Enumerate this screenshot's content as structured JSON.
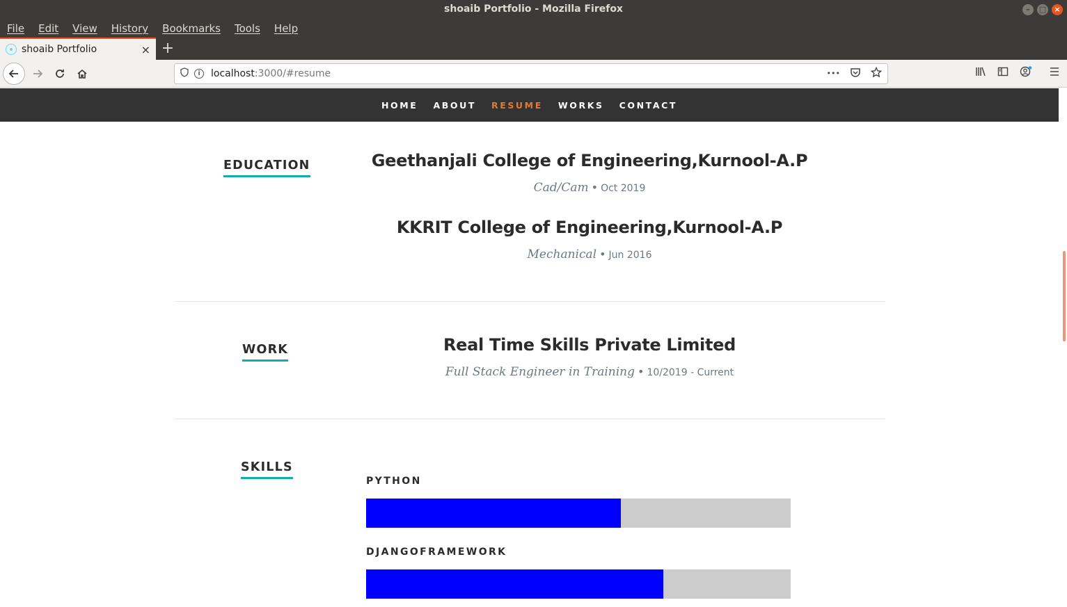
{
  "window": {
    "title": "shoaib Portfolio - Mozilla Firefox"
  },
  "menubar": {
    "items": [
      "File",
      "Edit",
      "View",
      "History",
      "Bookmarks",
      "Tools",
      "Help"
    ]
  },
  "tab": {
    "label": "shoaib Portfolio",
    "close_glyph": "×",
    "new_tab_glyph": "+"
  },
  "urlbar": {
    "host": "localhost",
    "path": ":3000/#resume",
    "more_glyph": "•••"
  },
  "site_nav": {
    "items": [
      "HOME",
      "ABOUT",
      "RESUME",
      "WORKS",
      "CONTACT"
    ],
    "current": "RESUME",
    "current_color": "#e47a2e"
  },
  "education": {
    "heading": "EDUCATION",
    "entries": [
      {
        "school": "Geethanjali College of Engineering,Kurnool-A.P",
        "degree": "Cad/Cam",
        "date": "Oct 2019"
      },
      {
        "school": "KKRIT College of Engineering,Kurnool-A.P",
        "degree": "Mechanical",
        "date": "Jun 2016"
      }
    ]
  },
  "work": {
    "heading": "WORK",
    "entries": [
      {
        "company": "Real Time Skills Private Limited",
        "title": "Full Stack Engineer in Training",
        "years": "10/2019 - Current"
      }
    ]
  },
  "skills": {
    "heading": "SKILLS",
    "items": [
      {
        "name": "PYTHON",
        "level": 0.6
      },
      {
        "name": "DJANGOFRAMEWORK",
        "level": 0.7
      }
    ],
    "bar_color": "#0000ff",
    "track_color": "#cccccc"
  },
  "colors": {
    "accent_underline": "#11abb0",
    "nav_background": "#333333"
  }
}
